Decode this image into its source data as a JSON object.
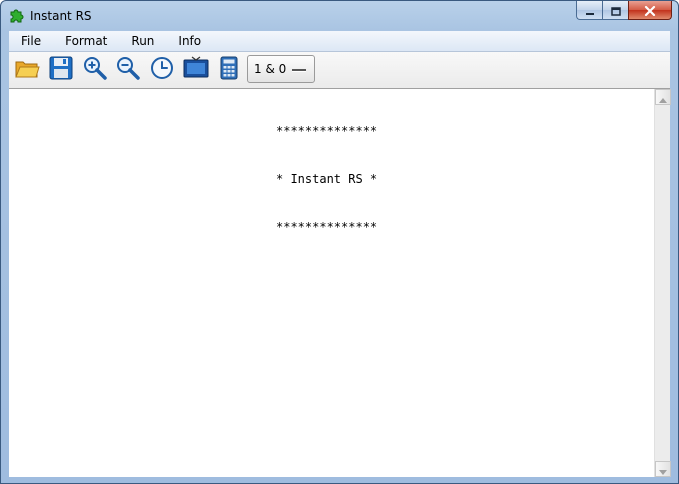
{
  "window": {
    "title": "Instant RS",
    "icon": "puzzle-piece-icon"
  },
  "caption_buttons": {
    "minimize_icon": "minimize-icon",
    "maximize_icon": "maximize-icon",
    "close_icon": "close-icon"
  },
  "menu": {
    "items": [
      {
        "label": "File"
      },
      {
        "label": "Format"
      },
      {
        "label": "Run"
      },
      {
        "label": "Info"
      }
    ]
  },
  "toolbar": {
    "tools": [
      {
        "icon": "open-folder-icon"
      },
      {
        "icon": "save-disk-icon"
      },
      {
        "icon": "zoom-in-icon"
      },
      {
        "icon": "zoom-out-icon"
      },
      {
        "icon": "clock-icon"
      },
      {
        "icon": "monitor-icon"
      },
      {
        "icon": "calculator-icon"
      }
    ],
    "mode_label": "1 & 0"
  },
  "output": {
    "lines": [
      "**************",
      "* Instant RS *",
      "**************"
    ]
  },
  "colors": {
    "titlebar": "#b9d1ea",
    "close_button": "#c2321c",
    "content_background": "#ffffff"
  }
}
